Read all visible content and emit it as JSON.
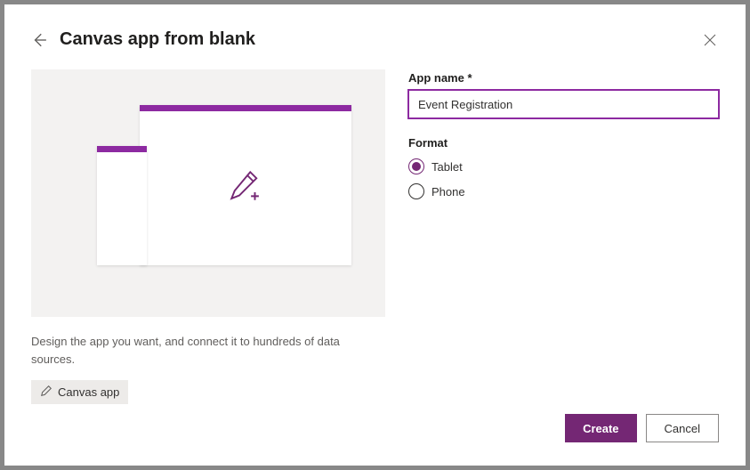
{
  "header": {
    "title": "Canvas app from blank"
  },
  "preview": {
    "description": "Design the app you want, and connect it to hundreds of data sources.",
    "tag_label": "Canvas app"
  },
  "form": {
    "app_name_label": "App name *",
    "app_name_value": "Event Registration",
    "format_label": "Format",
    "options": {
      "tablet": "Tablet",
      "phone": "Phone"
    }
  },
  "footer": {
    "create_label": "Create",
    "cancel_label": "Cancel"
  }
}
